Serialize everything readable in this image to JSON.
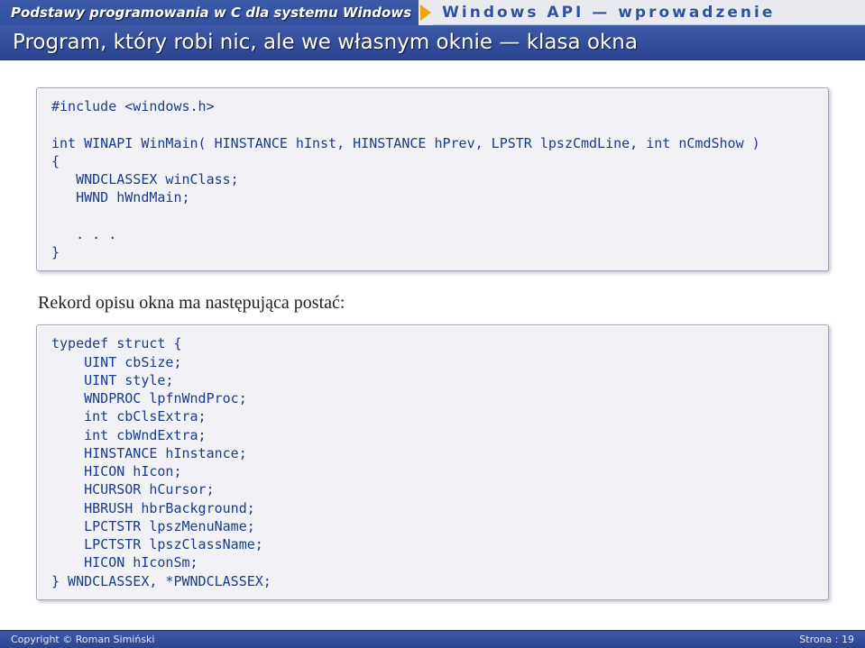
{
  "header": {
    "breadcrumb_left": "Podstawy programowania w C dla systemu Windows",
    "breadcrumb_right": "Windows API — wprowadzenie"
  },
  "title": "Program, który robi nic, ale we własnym oknie — klasa okna",
  "code1": "#include <windows.h>\n\nint WINAPI WinMain( HINSTANCE hInst, HINSTANCE hPrev, LPSTR lpszCmdLine, int nCmdShow )\n{\n   WNDCLASSEX winClass;\n   HWND hWndMain;\n\n   . . .\n}",
  "section_heading": "Rekord opisu okna ma następująca postać:",
  "code2": "typedef struct {\n    UINT cbSize;\n    UINT style;\n    WNDPROC lpfnWndProc;\n    int cbClsExtra;\n    int cbWndExtra;\n    HINSTANCE hInstance;\n    HICON hIcon;\n    HCURSOR hCursor;\n    HBRUSH hbrBackground;\n    LPCTSTR lpszMenuName;\n    LPCTSTR lpszClassName;\n    HICON hIconSm;\n} WNDCLASSEX, *PWNDCLASSEX;",
  "footer": {
    "left": "Copyright © Roman Simiński",
    "right": "Strona : 19"
  }
}
